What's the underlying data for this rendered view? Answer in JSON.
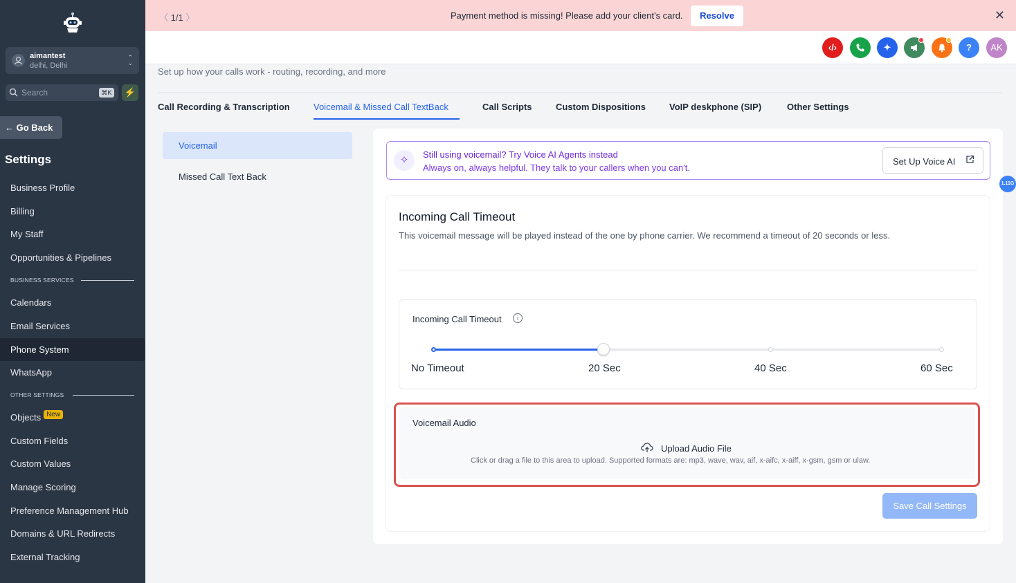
{
  "sidebar": {
    "account": {
      "name": "aimantest",
      "location": "delhi, Delhi"
    },
    "search": {
      "placeholder": "Search",
      "shortcut": "⌘K"
    },
    "go_back": "Go Back",
    "title": "Settings",
    "items": [
      {
        "label": "Business Profile"
      },
      {
        "label": "Billing"
      },
      {
        "label": "My Staff"
      },
      {
        "label": "Opportunities & Pipelines"
      },
      {
        "label": "Calendars"
      },
      {
        "label": "Email Services"
      },
      {
        "label": "Phone System",
        "active": true
      },
      {
        "label": "WhatsApp"
      },
      {
        "label": "Objects",
        "badge": "New"
      },
      {
        "label": "Custom Fields"
      },
      {
        "label": "Custom Values"
      },
      {
        "label": "Manage Scoring"
      },
      {
        "label": "Preference Management Hub"
      },
      {
        "label": "Domains & URL Redirects"
      },
      {
        "label": "External Tracking"
      }
    ],
    "sections": [
      "BUSINESS SERVICES",
      "OTHER SETTINGS"
    ]
  },
  "banner": {
    "pager": "1/1",
    "message": "Payment method is missing! Please add your client's card.",
    "resolve_label": "Resolve"
  },
  "header": {
    "icons": [
      {
        "name": "code-icon",
        "color": "#e11d1d"
      },
      {
        "name": "phone-icon",
        "color": "#16a34a"
      },
      {
        "name": "ai-sparkle-icon",
        "color": "#2563eb"
      },
      {
        "name": "megaphone-icon",
        "color": "#3f8a5f"
      },
      {
        "name": "bell-icon",
        "color": "#f97316"
      },
      {
        "name": "help-icon",
        "color": "#3b82f6"
      }
    ],
    "avatar_initials": "AK",
    "help_glyph": "?"
  },
  "page": {
    "subtitle": "Set up how your calls work - routing, recording, and more",
    "tabs": [
      {
        "label": "Call Recording & Transcription"
      },
      {
        "label": "Voicemail & Missed Call TextBack",
        "active": true
      },
      {
        "label": "Call Scripts"
      },
      {
        "label": "Custom Dispositions"
      },
      {
        "label": "VoIP deskphone (SIP)"
      },
      {
        "label": "Other Settings"
      }
    ],
    "subnav": [
      {
        "label": "Voicemail",
        "active": true
      },
      {
        "label": "Missed Call Text Back"
      }
    ]
  },
  "promo": {
    "title": "Still using voicemail? Try Voice AI Agents instead",
    "body": "Always on, always helpful. They talk to your callers when you can't.",
    "button_label": "Set Up Voice AI"
  },
  "version_badge": "1.11G",
  "timeout": {
    "title": "Incoming Call Timeout",
    "description": "This voicemail message will be played instead of the one by phone carrier. We recommend a timeout of 20 seconds or less.",
    "slider_label": "Incoming Call Timeout",
    "marks": [
      "No Timeout",
      "20 Sec",
      "40 Sec",
      "60 Sec"
    ],
    "selected_index": 1,
    "accent": "#2563eb"
  },
  "voicemail_audio": {
    "title": "Voicemail Audio",
    "upload_label": "Upload Audio File",
    "hint": "Click or drag a file to this area to upload. Supported formats are: mp3, wave, wav, aif, x-aifc, x-aiff, x-gsm, gsm or ulaw."
  },
  "save_label": "Save Call Settings"
}
